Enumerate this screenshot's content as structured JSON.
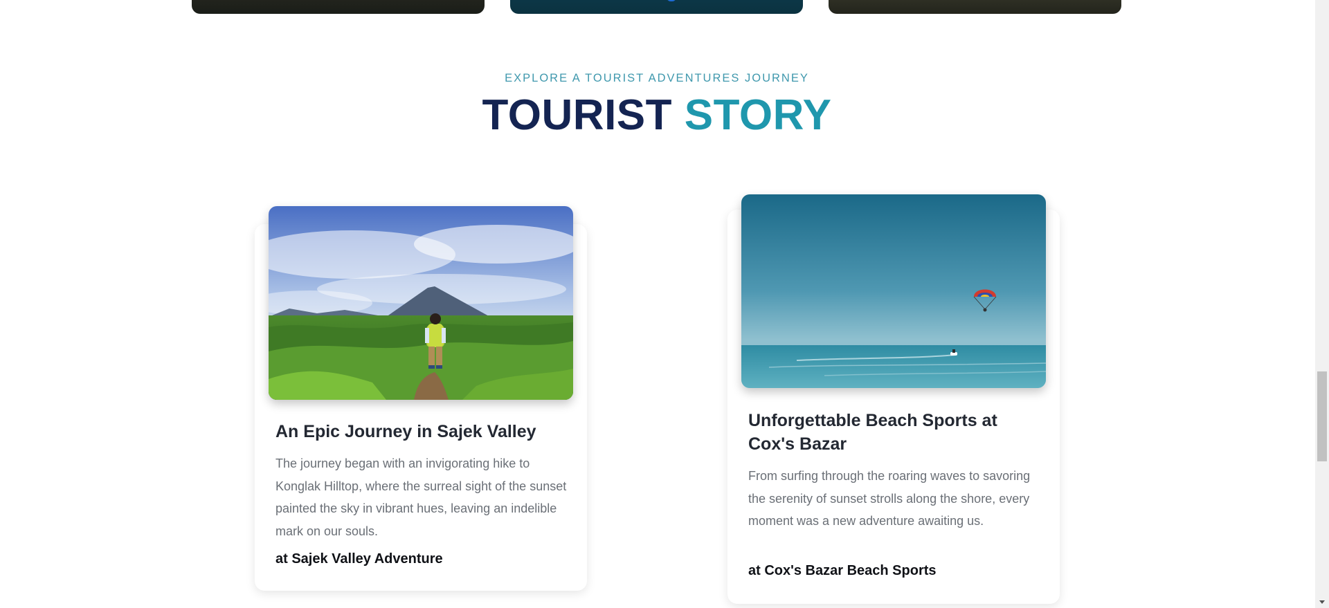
{
  "section": {
    "subtitle": "EXPLORE A TOURIST ADVENTURES JOURNEY",
    "title_part1": "TOURIST",
    "title_part2": "STORY"
  },
  "stories": [
    {
      "image": "hiker-mountain-valley-photo",
      "title": "An Epic Journey in Sajek Valley",
      "text": "The journey began with an invigorating hike to Konglak Hilltop, where the surreal sight of the sunset painted the sky in vibrant hues, leaving an indelible mark on our souls.",
      "location": "at Sajek Valley Adventure"
    },
    {
      "image": "parasailing-sea-photo",
      "title": "Unforgettable Beach Sports at Cox's Bazar",
      "text": "From surfing through the roaring waves to savoring the serenity of sunset strolls along the shore, every moment was a new adventure awaiting us.",
      "location": "at Cox's Bazar Beach Sports"
    }
  ],
  "colors": {
    "title_dark": "#142452",
    "accent_teal": "#1f97ad",
    "subtitle": "#3f98ad"
  }
}
